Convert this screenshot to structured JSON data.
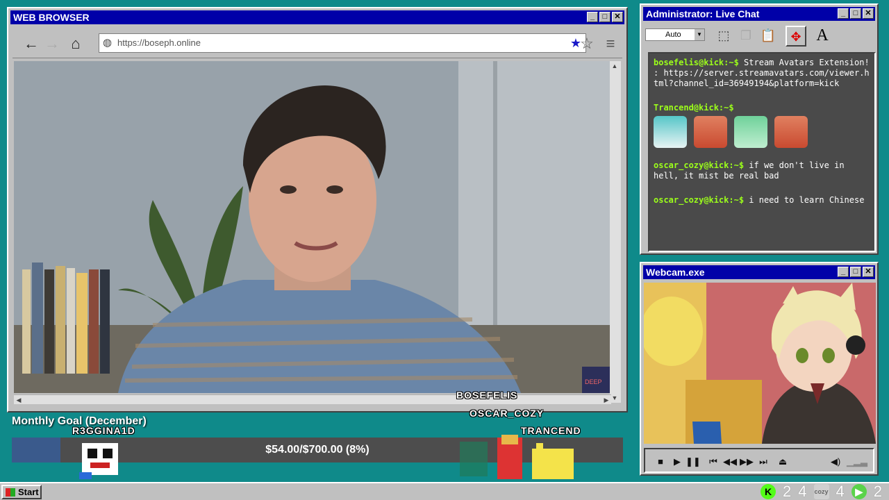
{
  "browser": {
    "title": "WEB BROWSER",
    "url": "https://boseph.online",
    "controls": [
      "_",
      "□",
      "✕"
    ]
  },
  "chat": {
    "title": "Administrator: Live Chat",
    "font_select": "Auto",
    "messages": [
      {
        "user": "bosefelis@kick:~$",
        "text": " Stream Avatars Extension! : https://server.streamavatars.com/viewer.html?channel_id=36949194&platform=kick"
      },
      {
        "user": "Trancend@kick:~$",
        "text": ""
      },
      {
        "user": "oscar_cozy@kick:~$",
        "text": " if we don't live in hell, it mist be real bad"
      },
      {
        "user": "oscar_cozy@kick:~$",
        "text": " i need to learn Chinese"
      }
    ]
  },
  "webcam": {
    "title": "Webcam.exe"
  },
  "goal": {
    "title": "Monthly Goal (December)",
    "progress_text": "$54.00/$700.00 (8%)",
    "progress_fraction": 0.08
  },
  "avatars": {
    "names": [
      "R3GGINA1D",
      "BOSEFELIS",
      "OSCAR_COZY",
      "TRANCEND"
    ]
  },
  "taskbar": {
    "start_label": "Start",
    "tray_counts": [
      "2",
      "4",
      "4",
      "2"
    ]
  },
  "colors": {
    "desktop": "#0f8a8a",
    "titlebar": "#0000a8",
    "chat_user": "#9cff1a",
    "kick_green": "#53fc18"
  }
}
